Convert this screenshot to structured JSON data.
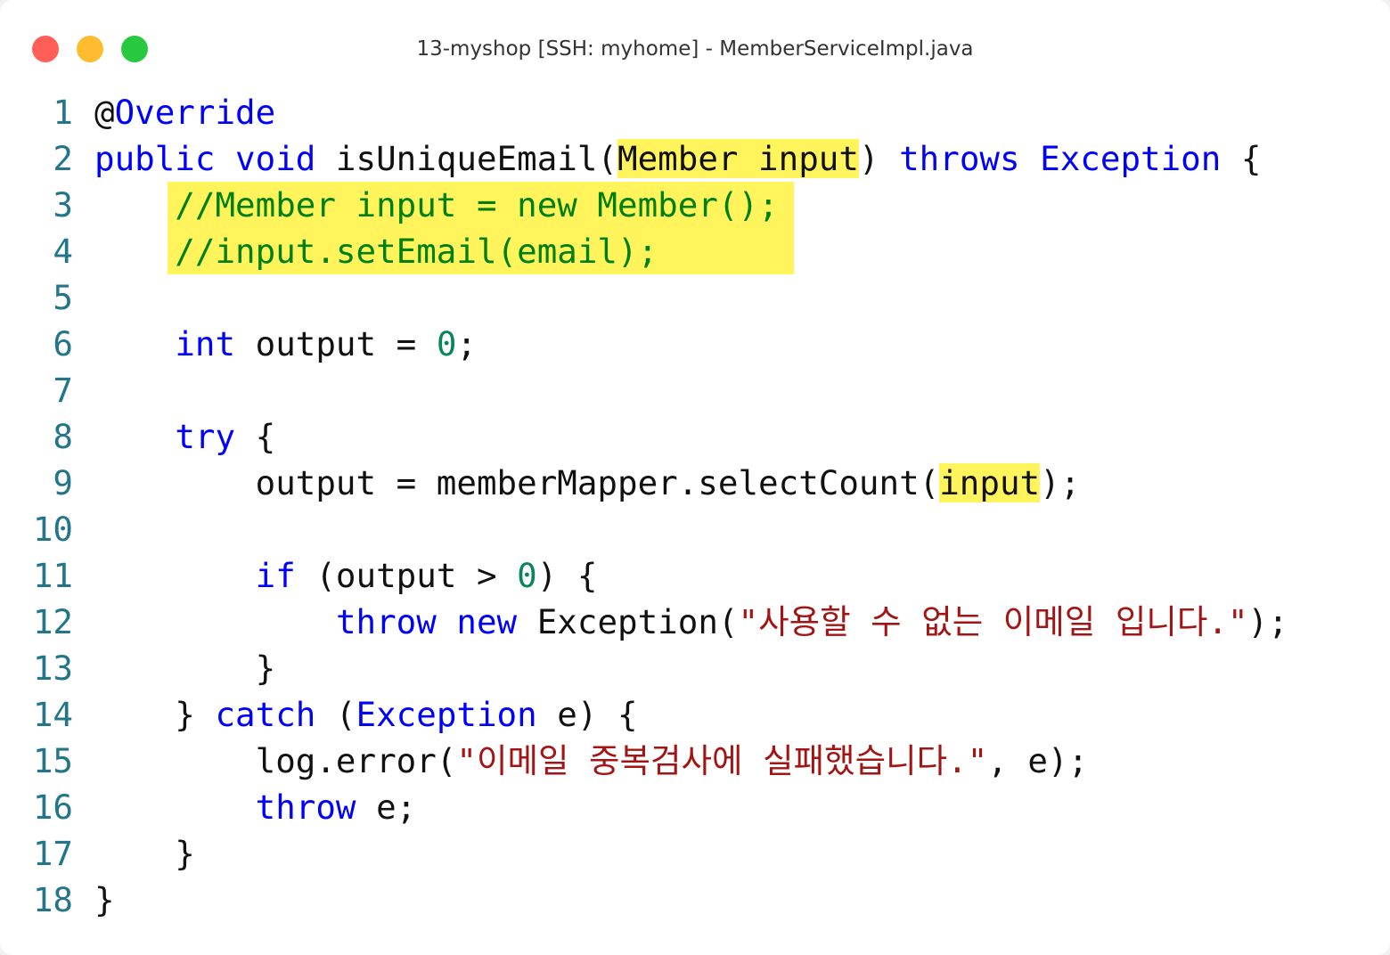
{
  "window": {
    "title": "13-myshop [SSH: myhome] - MemberServiceImpl.java",
    "controls": [
      "close",
      "minimize",
      "zoom"
    ]
  },
  "colors": {
    "keyword": "#0000ff",
    "comment": "#008000",
    "string": "#a31515",
    "number": "#098658",
    "line_number": "#23758a",
    "plain": "#111111",
    "highlight": "#fff45c",
    "close": "#ff5f57",
    "minimize": "#febc2e",
    "zoom": "#28c840"
  },
  "code": {
    "lines": [
      {
        "n": "1",
        "tokens": [
          {
            "t": "@",
            "c": "plain"
          },
          {
            "t": "Override",
            "c": "keyword"
          }
        ]
      },
      {
        "n": "2",
        "tokens": [
          {
            "t": "public void",
            "c": "keyword"
          },
          {
            "t": " isUniqueEmail(",
            "c": "plain"
          },
          {
            "t": "Member input",
            "c": "plain",
            "hl": true
          },
          {
            "t": ") ",
            "c": "plain"
          },
          {
            "t": "throws Exception",
            "c": "keyword"
          },
          {
            "t": " {",
            "c": "plain"
          }
        ]
      },
      {
        "n": "3",
        "hl_block": true,
        "tokens": [
          {
            "t": "    //Member input = new Member();",
            "c": "comment"
          }
        ]
      },
      {
        "n": "4",
        "hl_block": true,
        "tokens": [
          {
            "t": "    //input.setEmail(email);",
            "c": "comment"
          }
        ]
      },
      {
        "n": "5",
        "tokens": []
      },
      {
        "n": "6",
        "tokens": [
          {
            "t": "    ",
            "c": "plain"
          },
          {
            "t": "int",
            "c": "keyword"
          },
          {
            "t": " output = ",
            "c": "plain"
          },
          {
            "t": "0",
            "c": "number"
          },
          {
            "t": ";",
            "c": "plain"
          }
        ]
      },
      {
        "n": "7",
        "tokens": []
      },
      {
        "n": "8",
        "tokens": [
          {
            "t": "    ",
            "c": "plain"
          },
          {
            "t": "try",
            "c": "keyword"
          },
          {
            "t": " {",
            "c": "plain"
          }
        ]
      },
      {
        "n": "9",
        "tokens": [
          {
            "t": "        output = memberMapper.selectCount(",
            "c": "plain"
          },
          {
            "t": "input",
            "c": "plain",
            "hl": true
          },
          {
            "t": ");",
            "c": "plain"
          }
        ]
      },
      {
        "n": "10",
        "tokens": []
      },
      {
        "n": "11",
        "tokens": [
          {
            "t": "        ",
            "c": "plain"
          },
          {
            "t": "if",
            "c": "keyword"
          },
          {
            "t": " (output > ",
            "c": "plain"
          },
          {
            "t": "0",
            "c": "number"
          },
          {
            "t": ") {",
            "c": "plain"
          }
        ]
      },
      {
        "n": "12",
        "tokens": [
          {
            "t": "            ",
            "c": "plain"
          },
          {
            "t": "throw new",
            "c": "keyword"
          },
          {
            "t": " Exception(",
            "c": "plain"
          },
          {
            "t": "\"사용할 수 없는 이메일 입니다.\"",
            "c": "string"
          },
          {
            "t": ");",
            "c": "plain"
          }
        ]
      },
      {
        "n": "13",
        "tokens": [
          {
            "t": "        }",
            "c": "plain"
          }
        ]
      },
      {
        "n": "14",
        "tokens": [
          {
            "t": "    } ",
            "c": "plain"
          },
          {
            "t": "catch",
            "c": "keyword"
          },
          {
            "t": " (",
            "c": "plain"
          },
          {
            "t": "Exception",
            "c": "keyword"
          },
          {
            "t": " e) {",
            "c": "plain"
          }
        ]
      },
      {
        "n": "15",
        "tokens": [
          {
            "t": "        log.error(",
            "c": "plain"
          },
          {
            "t": "\"이메일 중복검사에 실패했습니다.\"",
            "c": "string"
          },
          {
            "t": ", e);",
            "c": "plain"
          }
        ]
      },
      {
        "n": "16",
        "tokens": [
          {
            "t": "        ",
            "c": "plain"
          },
          {
            "t": "throw",
            "c": "keyword"
          },
          {
            "t": " e;",
            "c": "plain"
          }
        ]
      },
      {
        "n": "17",
        "tokens": [
          {
            "t": "    }",
            "c": "plain"
          }
        ]
      },
      {
        "n": "18",
        "tokens": [
          {
            "t": "}",
            "c": "plain"
          }
        ]
      }
    ]
  }
}
